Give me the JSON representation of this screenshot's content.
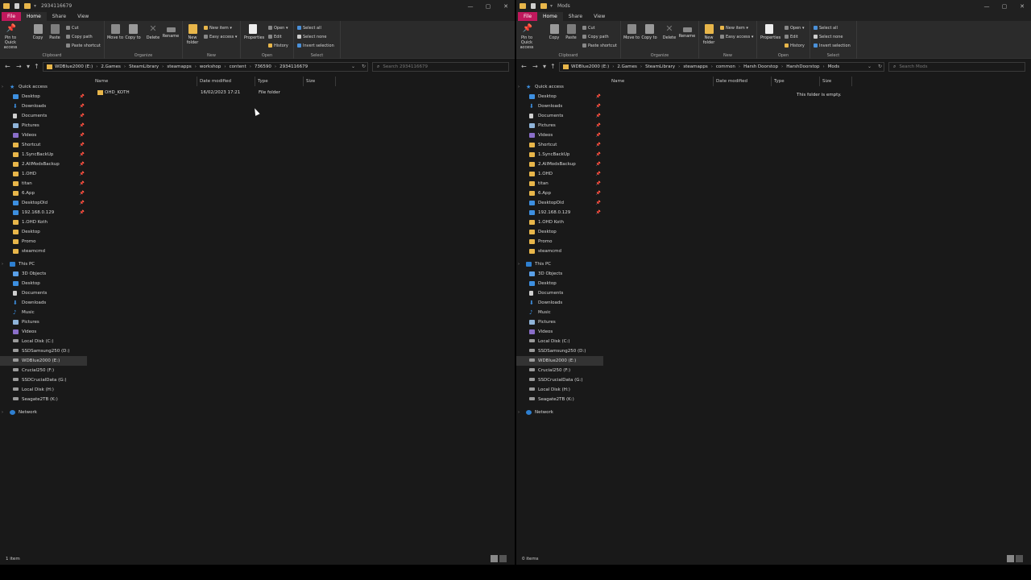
{
  "left": {
    "title": "2934116679",
    "tabs": {
      "file": "File",
      "home": "Home",
      "share": "Share",
      "view": "View"
    },
    "ribbon": {
      "pin": "Pin to Quick access",
      "copy": "Copy",
      "paste": "Paste",
      "cut": "Cut",
      "copy_path": "Copy path",
      "paste_shortcut": "Paste shortcut",
      "move_to": "Move to",
      "copy_to": "Copy to",
      "delete": "Delete",
      "rename": "Rename",
      "new_folder": "New folder",
      "new_item": "New item ▾",
      "easy_access": "Easy access ▾",
      "properties": "Properties",
      "open": "Open ▾",
      "edit": "Edit",
      "history": "History",
      "select_all": "Select all",
      "select_none": "Select none",
      "invert_selection": "Invert selection",
      "groups": {
        "clipboard": "Clipboard",
        "organize": "Organize",
        "new": "New",
        "open": "Open",
        "select": "Select"
      }
    },
    "breadcrumb": [
      "WDBlue2000 (E:)",
      "2.Games",
      "SteamLibrary",
      "steamapps",
      "workshop",
      "content",
      "736590",
      "2934116679"
    ],
    "search_placeholder": "Search 2934116679",
    "columns": {
      "name": "Name",
      "date": "Date modified",
      "type": "Type",
      "size": "Size"
    },
    "files": [
      {
        "name": "OHD_KOTH",
        "date": "16/02/2023 17:21",
        "type": "File folder",
        "size": ""
      }
    ],
    "status": "1 item"
  },
  "right": {
    "title": "Mods",
    "breadcrumb": [
      "WDBlue2000 (E:)",
      "2.Games",
      "SteamLibrary",
      "steamapps",
      "common",
      "Harsh Doorstop",
      "HarshDoorstop",
      "Mods"
    ],
    "search_placeholder": "Search Mods",
    "empty_message": "This folder is empty.",
    "status": "0 items"
  },
  "nav": {
    "quick_access": "Quick access",
    "quick_items": [
      {
        "label": "Desktop",
        "icon": "desktop-icon",
        "pinned": true
      },
      {
        "label": "Downloads",
        "icon": "download-icon",
        "pinned": true
      },
      {
        "label": "Documents",
        "icon": "documents-icon",
        "pinned": true
      },
      {
        "label": "Pictures",
        "icon": "pictures-icon",
        "pinned": true
      },
      {
        "label": "Videos",
        "icon": "videos-icon",
        "pinned": true
      },
      {
        "label": "Shortcut",
        "icon": "folder-icon",
        "pinned": true
      },
      {
        "label": "1.SyncBackUp",
        "icon": "folder-icon",
        "pinned": true
      },
      {
        "label": "2.AllModsBackup",
        "icon": "folder-icon",
        "pinned": true
      },
      {
        "label": "1.OHD",
        "icon": "folder-icon",
        "pinned": true
      },
      {
        "label": "titan",
        "icon": "folder-icon",
        "pinned": true
      },
      {
        "label": "6.App",
        "icon": "folder-icon",
        "pinned": true
      },
      {
        "label": "DesktopOld",
        "icon": "desktop-icon",
        "pinned": true
      },
      {
        "label": "192.168.0.129",
        "icon": "network-drive-icon",
        "pinned": true
      },
      {
        "label": "1.OHD Koth",
        "icon": "folder-icon",
        "pinned": false
      },
      {
        "label": "Desktop",
        "icon": "folder-icon",
        "pinned": false
      },
      {
        "label": "Promo",
        "icon": "folder-icon",
        "pinned": false
      },
      {
        "label": "steamcmd",
        "icon": "folder-icon",
        "pinned": false
      }
    ],
    "this_pc": "This PC",
    "pc_items": [
      {
        "label": "3D Objects",
        "icon": "3d-objects-icon"
      },
      {
        "label": "Desktop",
        "icon": "desktop-icon"
      },
      {
        "label": "Documents",
        "icon": "documents-icon"
      },
      {
        "label": "Downloads",
        "icon": "download-icon"
      },
      {
        "label": "Music",
        "icon": "music-icon"
      },
      {
        "label": "Pictures",
        "icon": "pictures-icon"
      },
      {
        "label": "Videos",
        "icon": "videos-icon"
      },
      {
        "label": "Local Disk (C:)",
        "icon": "drive-icon"
      },
      {
        "label": "SSDSamsung250 (D:)",
        "icon": "drive-icon"
      },
      {
        "label": "WDBlue2000 (E:)",
        "icon": "drive-icon",
        "selected": true
      },
      {
        "label": "Crucial250 (F:)",
        "icon": "drive-icon"
      },
      {
        "label": "SSDCrucialData (G:)",
        "icon": "drive-icon"
      },
      {
        "label": "Local Disk (H:)",
        "icon": "drive-icon"
      },
      {
        "label": "Seagate2TB (K:)",
        "icon": "drive-icon"
      }
    ],
    "network": "Network"
  },
  "colors": {
    "file_tab": "#c0185c",
    "folder": "#e8b64a",
    "accent_blue": "#3d8fe0",
    "background": "#191919"
  }
}
